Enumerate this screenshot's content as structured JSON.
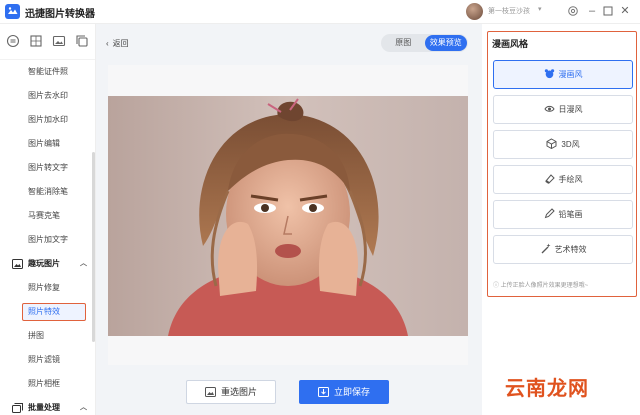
{
  "app": {
    "title": "迅捷图片转换器",
    "brand_color": "#2f6ff0",
    "accent_color": "#e0623d"
  },
  "user": {
    "name": "第一枝豆沙孩"
  },
  "window_controls": [
    "settings-icon",
    "minimize-icon",
    "maximize-icon",
    "close-icon"
  ],
  "sidebar": {
    "tool_icons": [
      "convert-icon",
      "crop-icon",
      "image-icon",
      "copy-icon"
    ],
    "items_top": [
      {
        "label": "智能证件照"
      },
      {
        "label": "图片去水印"
      },
      {
        "label": "图片加水印"
      },
      {
        "label": "图片编辑"
      },
      {
        "label": "图片转文字"
      },
      {
        "label": "智能消除笔"
      },
      {
        "label": "马赛克笔"
      },
      {
        "label": "图片加文字"
      }
    ],
    "section_fun": {
      "label": "趣玩图片",
      "icon": "image-icon"
    },
    "items_fun": [
      {
        "label": "照片修复"
      },
      {
        "label": "照片特效"
      },
      {
        "label": "拼图"
      },
      {
        "label": "照片滤镜"
      },
      {
        "label": "照片相框"
      }
    ],
    "active_item": "照片特效",
    "section_batch": {
      "label": "批量处理",
      "icon": "batch-icon"
    }
  },
  "main": {
    "back_label": "返回",
    "view_tabs": [
      {
        "label": "原图"
      },
      {
        "label": "效果预览"
      }
    ],
    "active_view": "效果预览",
    "reselect_label": "重选图片",
    "save_label": "立即保存"
  },
  "style_panel": {
    "title": "漫画风格",
    "options": [
      {
        "label": "漫画风",
        "icon": "bear-icon"
      },
      {
        "label": "日漫风",
        "icon": "eye-icon"
      },
      {
        "label": "3D风",
        "icon": "cube-icon"
      },
      {
        "label": "手绘风",
        "icon": "eraser-icon"
      },
      {
        "label": "铅笔画",
        "icon": "pencil-icon"
      },
      {
        "label": "艺术特效",
        "icon": "magic-wand-icon"
      }
    ],
    "selected": "漫画风",
    "tip": "上传正脸人像照片效果更理想哦~"
  },
  "watermark": {
    "text": "云南龙网"
  }
}
